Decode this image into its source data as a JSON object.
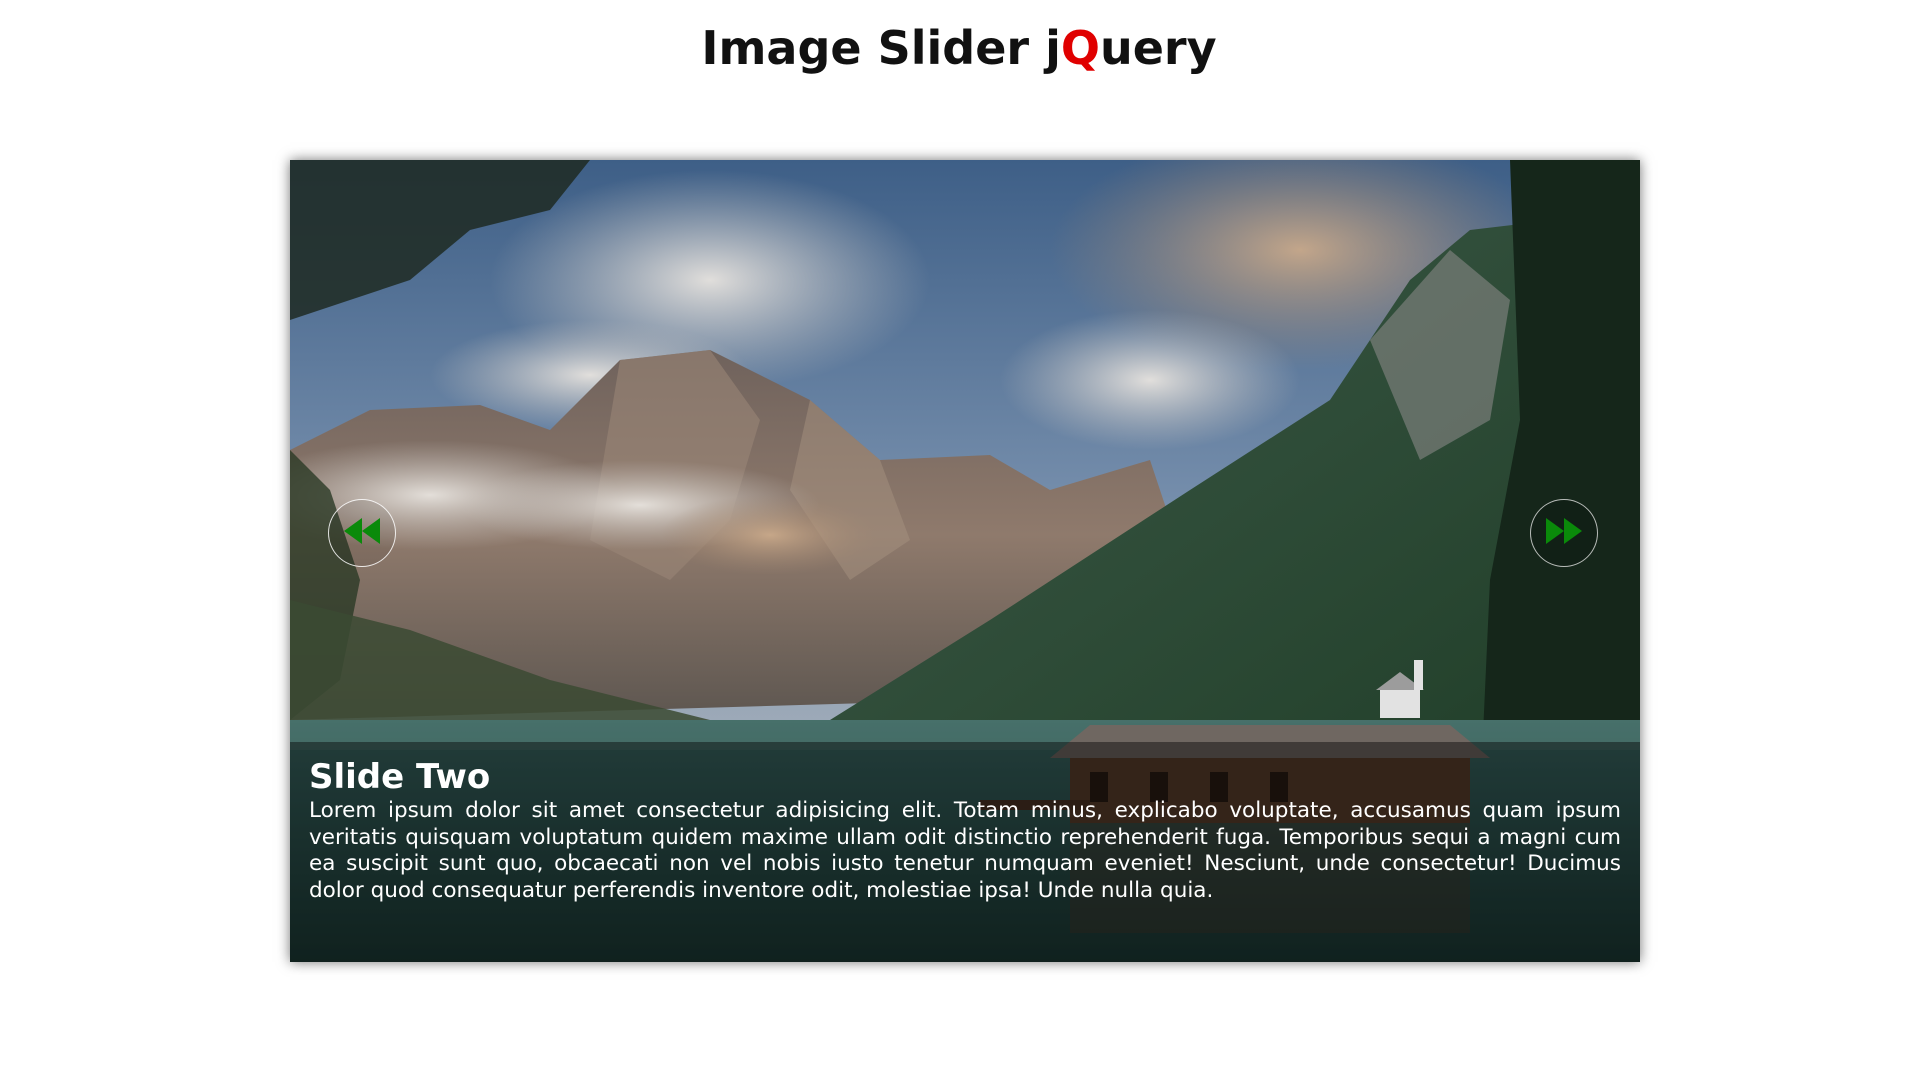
{
  "page": {
    "title_prefix": "Image Slider j",
    "title_accent": "Q",
    "title_suffix": "uery",
    "accent_color": "#e00000"
  },
  "slider": {
    "prev_icon": "rewind-icon",
    "next_icon": "fast-forward-icon",
    "icon_color": "#0a8a0a",
    "slide": {
      "title": "Slide Two",
      "text": "Lorem ipsum dolor sit amet consectetur adipisicing elit. Totam minus, explicabo voluptate, accusamus quam ipsum veritatis quisquam voluptatum quidem maxime ullam odit distinctio reprehenderit fuga. Temporibus sequi a magni cum ea suscipit sunt quo, obcaecati non vel nobis iusto tenetur numquam eveniet! Nesciunt, unde consectetur! Ducimus dolor quod consequatur perferendis inventore odit, molestiae ipsa! Unde nulla quia."
    }
  }
}
